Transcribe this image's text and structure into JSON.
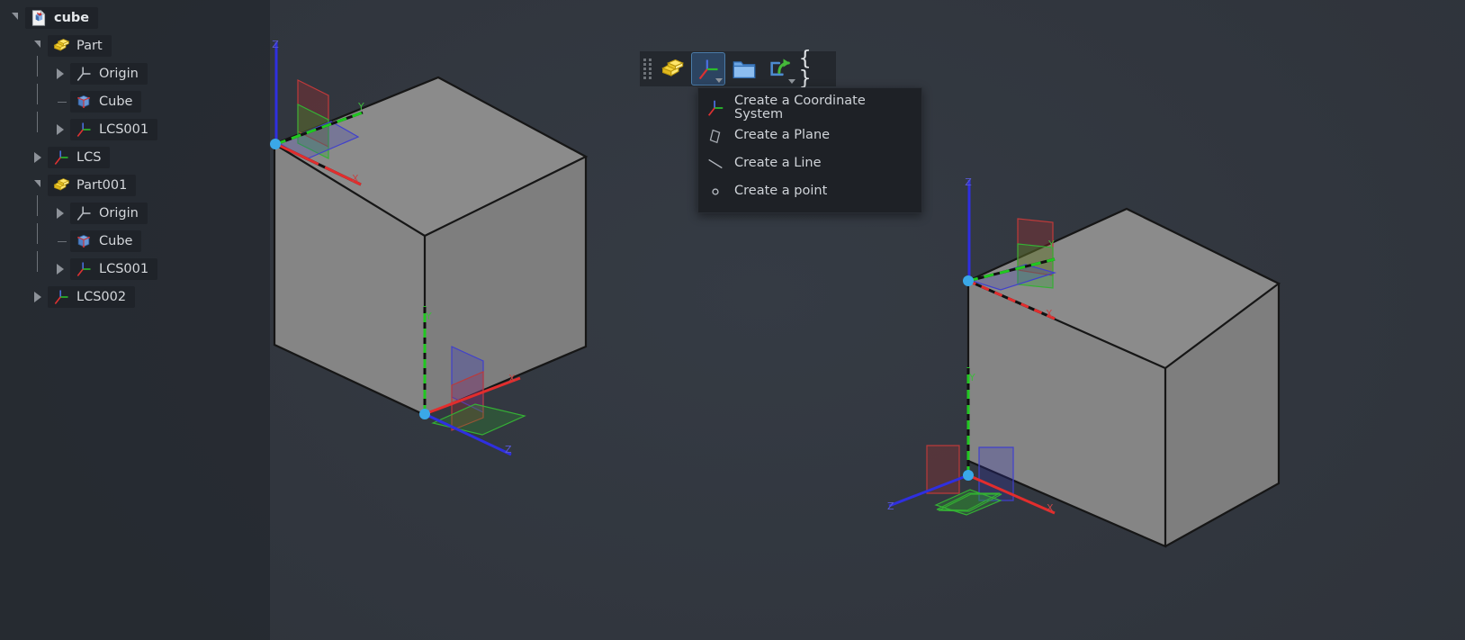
{
  "app": {
    "background_color": "#31363e",
    "panel_color": "#262a31"
  },
  "tree": {
    "items": [
      {
        "label": "cube",
        "icon": "document-cube-icon",
        "indent": 0,
        "toggle": "expanded",
        "bold": true,
        "connector": "none"
      },
      {
        "label": "Part",
        "icon": "part-icon",
        "indent": 1,
        "toggle": "expanded",
        "bold": false,
        "connector": "none"
      },
      {
        "label": "Origin",
        "icon": "origin-axes-icon",
        "indent": 2,
        "toggle": "collapsed",
        "bold": false,
        "connector": "stem"
      },
      {
        "label": "Cube",
        "icon": "cube-solid-icon",
        "indent": 2,
        "toggle": "none",
        "bold": false,
        "connector": "branch"
      },
      {
        "label": "LCS001",
        "icon": "coordinate-system-icon",
        "indent": 2,
        "toggle": "collapsed",
        "bold": false,
        "connector": "stem"
      },
      {
        "label": "LCS",
        "icon": "coordinate-system-icon",
        "indent": 1,
        "toggle": "collapsed",
        "bold": false,
        "connector": "none"
      },
      {
        "label": "Part001",
        "icon": "part-icon",
        "indent": 1,
        "toggle": "expanded",
        "bold": false,
        "connector": "none"
      },
      {
        "label": "Origin",
        "icon": "origin-axes-icon",
        "indent": 2,
        "toggle": "collapsed",
        "bold": false,
        "connector": "stem"
      },
      {
        "label": "Cube",
        "icon": "cube-solid-icon",
        "indent": 2,
        "toggle": "none",
        "bold": false,
        "connector": "branch"
      },
      {
        "label": "LCS001",
        "icon": "coordinate-system-icon",
        "indent": 2,
        "toggle": "collapsed",
        "bold": false,
        "connector": "stem"
      },
      {
        "label": "LCS002",
        "icon": "coordinate-system-icon",
        "indent": 1,
        "toggle": "collapsed",
        "bold": false,
        "connector": "none"
      }
    ]
  },
  "toolbar": {
    "buttons": [
      {
        "name": "create-part-button",
        "icon": "part-icon",
        "active": false,
        "has_caret": false
      },
      {
        "name": "create-coordinate-system-button",
        "icon": "coordinate-system-icon",
        "active": true,
        "has_caret": true
      },
      {
        "name": "create-group-button",
        "icon": "folder-icon",
        "active": false,
        "has_caret": false
      },
      {
        "name": "export-button",
        "icon": "share-export-icon",
        "active": false,
        "has_caret": true
      },
      {
        "name": "expression-button",
        "icon": "braces-icon",
        "active": false,
        "has_caret": false,
        "glyph": "{ }"
      }
    ]
  },
  "dropdown": {
    "items": [
      {
        "label": "Create a Coordinate System",
        "icon": "coordinate-system-icon"
      },
      {
        "label": "Create a Plane",
        "icon": "plane-icon"
      },
      {
        "label": "Create a Line",
        "icon": "line-icon"
      },
      {
        "label": "Create a point",
        "icon": "point-icon"
      }
    ]
  },
  "viewport": {
    "objects": [
      {
        "name": "cube-left",
        "axis_labels": {
          "x": "X",
          "y": "Y",
          "z": "Z"
        },
        "lcs_widgets": [
          "lcs-top-left",
          "lcs-bottom"
        ]
      },
      {
        "name": "cube-right",
        "axis_labels": {
          "x": "X",
          "y": "Y",
          "z": "Z"
        },
        "lcs_widgets": [
          "lcs-top-left",
          "lcs-bottom"
        ]
      }
    ],
    "colors": {
      "x_axis": "#e03030",
      "y_axis": "#26c626",
      "z_axis": "#3333e0",
      "vertex": "#3aa8e8",
      "face_top": "#8a8a8a",
      "face_left": "#838383",
      "face_right": "#7d7d7d",
      "edge": "#1a1a1a"
    }
  }
}
